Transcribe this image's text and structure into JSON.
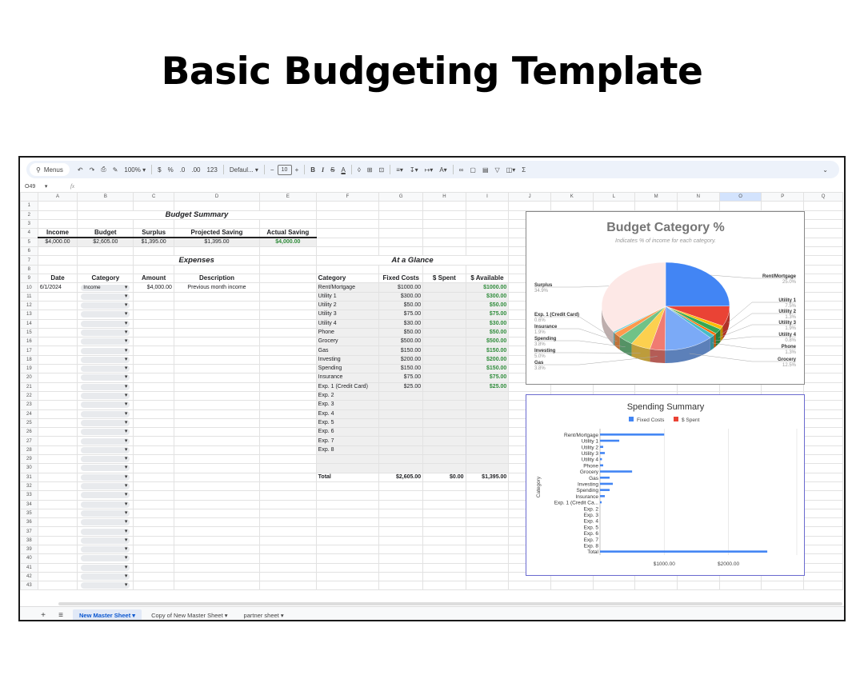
{
  "page_title": "Basic Budgeting Template",
  "toolbar": {
    "menus": "Menus",
    "zoom": "100%",
    "currency": "$",
    "percent": "%",
    "dec_less": ".0",
    "dec_more": ".00",
    "number_fmt": "123",
    "font": "Defaul...",
    "font_size": "10",
    "bold": "B",
    "italic": "I",
    "strike": "S",
    "text_color": "A",
    "sigma": "Σ"
  },
  "namebox": {
    "cell": "O49",
    "fx": "fx"
  },
  "columns": [
    "A",
    "B",
    "C",
    "D",
    "E",
    "F",
    "G",
    "H",
    "I",
    "J",
    "K",
    "L",
    "M",
    "N",
    "O",
    "P",
    "Q"
  ],
  "rows": [
    "1",
    "2",
    "3",
    "4",
    "5",
    "6",
    "7",
    "8",
    "9",
    "10",
    "11",
    "12",
    "13",
    "14",
    "15",
    "16",
    "17",
    "18",
    "19",
    "20",
    "21",
    "22",
    "23",
    "24",
    "25",
    "26",
    "27",
    "28",
    "29",
    "30",
    "31",
    "32",
    "33",
    "34",
    "35",
    "36",
    "37",
    "38",
    "39",
    "40",
    "41",
    "42",
    "43"
  ],
  "budget_summary": {
    "title": "Budget Summary",
    "headers": [
      "Income",
      "Budget",
      "Surplus",
      "Projected Saving",
      "Actual Saving"
    ],
    "values": [
      "$4,000.00",
      "$2,605.00",
      "$1,395.00",
      "$1,395.00",
      "$4,000.00"
    ]
  },
  "expenses": {
    "title": "Expenses",
    "headers": [
      "Date",
      "Category",
      "Amount",
      "Description"
    ],
    "entry": {
      "date": "6/1/2024",
      "category": "Income",
      "amount": "$4,000.00",
      "description": "Previous month income"
    }
  },
  "glance": {
    "title": "At a Glance",
    "headers": [
      "Category",
      "Fixed Costs",
      "$ Spent",
      "$ Available"
    ],
    "rows": [
      [
        "Rent/Mortgage",
        "$1000.00",
        "",
        "$1000.00"
      ],
      [
        "Utility 1",
        "$300.00",
        "",
        "$300.00"
      ],
      [
        "Utility 2",
        "$50.00",
        "",
        "$50.00"
      ],
      [
        "Utility 3",
        "$75.00",
        "",
        "$75.00"
      ],
      [
        "Utility 4",
        "$30.00",
        "",
        "$30.00"
      ],
      [
        "Phone",
        "$50.00",
        "",
        "$50.00"
      ],
      [
        "Grocery",
        "$500.00",
        "",
        "$500.00"
      ],
      [
        "Gas",
        "$150.00",
        "",
        "$150.00"
      ],
      [
        "Investing",
        "$200.00",
        "",
        "$200.00"
      ],
      [
        "Spending",
        "$150.00",
        "",
        "$150.00"
      ],
      [
        "Insurance",
        "$75.00",
        "",
        "$75.00"
      ],
      [
        "Exp. 1 (Credit Card)",
        "$25.00",
        "",
        "$25.00"
      ],
      [
        "Exp. 2",
        "",
        "",
        ""
      ],
      [
        "Exp. 3",
        "",
        "",
        ""
      ],
      [
        "Exp. 4",
        "",
        "",
        ""
      ],
      [
        "Exp. 5",
        "",
        "",
        ""
      ],
      [
        "Exp. 6",
        "",
        "",
        ""
      ],
      [
        "Exp. 7",
        "",
        "",
        ""
      ],
      [
        "Exp. 8",
        "",
        "",
        ""
      ]
    ],
    "total": [
      "Total",
      "$2,605.00",
      "$0.00",
      "$1,395.00"
    ]
  },
  "sheet_tabs": [
    "New Master Sheet",
    "Copy of New Master Sheet",
    "partner sheet"
  ],
  "chart_data": [
    {
      "type": "pie",
      "title": "Budget Category %",
      "subtitle": "Indicates % of income for each category.",
      "slices": [
        {
          "label": "Rent/Mortgage",
          "pct": "25.0%",
          "value": 25.0,
          "color": "#4285f4"
        },
        {
          "label": "Utility 1",
          "pct": "7.5%",
          "value": 7.5,
          "color": "#ea4335"
        },
        {
          "label": "Utility 2",
          "pct": "1.3%",
          "value": 1.3,
          "color": "#fbbc04"
        },
        {
          "label": "Utility 3",
          "pct": "1.9%",
          "value": 1.9,
          "color": "#34a853"
        },
        {
          "label": "Utility 4",
          "pct": "0.8%",
          "value": 0.8,
          "color": "#ff6d01"
        },
        {
          "label": "Phone",
          "pct": "1.3%",
          "value": 1.3,
          "color": "#46bdc6"
        },
        {
          "label": "Grocery",
          "pct": "12.5%",
          "value": 12.5,
          "color": "#7baaf7"
        },
        {
          "label": "Gas",
          "pct": "3.8%",
          "value": 3.8,
          "color": "#f07b72"
        },
        {
          "label": "Investing",
          "pct": "5.0%",
          "value": 5.0,
          "color": "#fcd04f"
        },
        {
          "label": "Spending",
          "pct": "3.8%",
          "value": 3.8,
          "color": "#71c287"
        },
        {
          "label": "Insurance",
          "pct": "1.9%",
          "value": 1.9,
          "color": "#ff994d"
        },
        {
          "label": "Exp. 1 (Credit Card)",
          "pct": "0.6%",
          "value": 0.6,
          "color": "#7ed1d7"
        },
        {
          "label": "Surplus",
          "pct": "34.9%",
          "value": 34.9,
          "color": "#fde8e6"
        }
      ]
    },
    {
      "type": "bar",
      "title": "Spending Summary",
      "ylabel": "Category",
      "xlim": [
        0,
        2605
      ],
      "xticks": [
        "$1000.00",
        "$2000.00"
      ],
      "xtick_values": [
        1000,
        2000
      ],
      "categories": [
        "Rent/Mortgage",
        "Utility 1",
        "Utility 2",
        "Utility 3",
        "Utility 4",
        "Phone",
        "Grocery",
        "Gas",
        "Investing",
        "Spending",
        "Insurance",
        "Exp. 1 (Credit Ca...",
        "Exp. 2",
        "Exp. 3",
        "Exp. 4",
        "Exp. 5",
        "Exp. 6",
        "Exp. 7",
        "Exp. 8",
        "Total"
      ],
      "series": [
        {
          "name": "Fixed Costs",
          "color": "#4285f4",
          "values": [
            1000,
            300,
            50,
            75,
            30,
            50,
            500,
            150,
            200,
            150,
            75,
            25,
            0,
            0,
            0,
            0,
            0,
            0,
            0,
            2605
          ]
        },
        {
          "name": "$ Spent",
          "color": "#ea4335",
          "values": [
            0,
            0,
            0,
            0,
            0,
            0,
            0,
            0,
            0,
            0,
            0,
            0,
            0,
            0,
            0,
            0,
            0,
            0,
            0,
            0
          ]
        }
      ]
    }
  ]
}
